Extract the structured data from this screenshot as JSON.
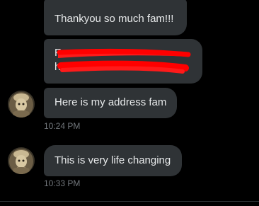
{
  "messages": [
    {
      "text": "Thankyou so much fam!!!",
      "avatar": false
    },
    {
      "redacted_lines": [
        "F",
        "h"
      ],
      "avatar": false
    },
    {
      "text": "Here is my address fam",
      "avatar": true,
      "timestamp": "10:24 PM"
    },
    {
      "text": "This is very life changing",
      "avatar": true,
      "timestamp": "10:33 PM"
    }
  ],
  "colors": {
    "background": "#000000",
    "bubble": "#2f3336",
    "text": "#e7e9ea",
    "timestamp": "#71767b",
    "redaction": "#ff0000"
  }
}
